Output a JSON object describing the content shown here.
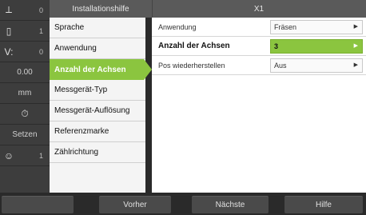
{
  "status": {
    "rows": [
      {
        "icon": "axis-icon",
        "glyph": "⟂",
        "value": "0"
      },
      {
        "icon": "tool-icon",
        "glyph": "▯",
        "value": "1"
      },
      {
        "icon": "feed-icon",
        "glyph": "V:",
        "value": "0"
      },
      {
        "icon": "",
        "glyph": "",
        "value": "0.00"
      },
      {
        "icon": "",
        "glyph": "",
        "value": "mm"
      },
      {
        "icon": "timer-icon",
        "glyph": "⏱",
        "value": ""
      },
      {
        "icon": "",
        "glyph": "",
        "value": "Setzen"
      },
      {
        "icon": "user-icon",
        "glyph": "☺",
        "value": "1"
      }
    ]
  },
  "header": {
    "left_title": "Installationshilfe",
    "right_title": "X1"
  },
  "menu": {
    "items": [
      {
        "label": "Sprache",
        "active": false
      },
      {
        "label": "Anwendung",
        "active": false
      },
      {
        "label": "Anzahl der Achsen",
        "active": true
      },
      {
        "label": "Messgerät-Typ",
        "active": false
      },
      {
        "label": "Messgerät-Auflösung",
        "active": false
      },
      {
        "label": "Referenzmarke",
        "active": false
      },
      {
        "label": "Zählrichtung",
        "active": false
      }
    ]
  },
  "panel": {
    "settings": [
      {
        "label": "Anwendung",
        "value": "Fräsen",
        "active": false
      },
      {
        "label": "Anzahl der Achsen",
        "value": "3",
        "active": true
      },
      {
        "label": "Pos wiederherstellen",
        "value": "Aus",
        "active": false
      }
    ]
  },
  "softkeys": {
    "k1": "",
    "k2": "Vorher",
    "k3": "Nächste",
    "k4": "Hilfe"
  },
  "colors": {
    "accent": "#8bc53f",
    "header": "#5a5a5a",
    "status_bg": "#3d3d3d"
  }
}
